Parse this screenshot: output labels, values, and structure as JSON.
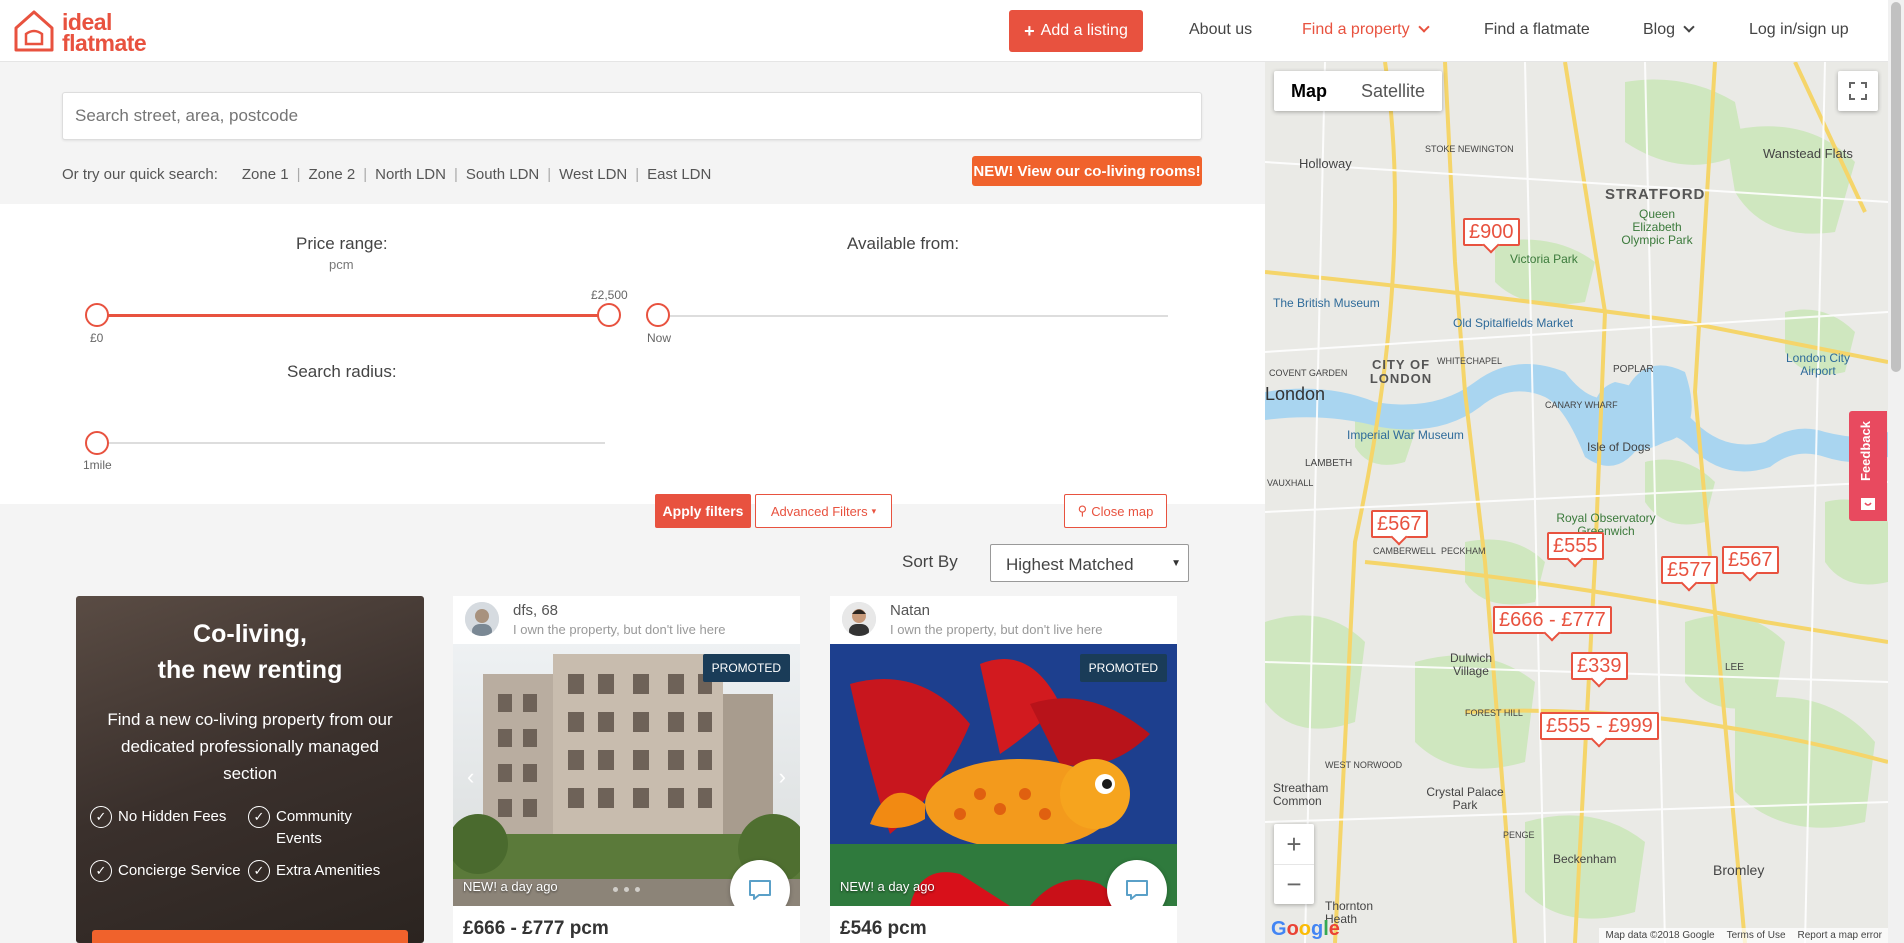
{
  "brand": {
    "line1": "ideal",
    "line2": "flatmate",
    "color": "#e8523f"
  },
  "header": {
    "add_listing": "Add a listing",
    "nav": {
      "about": "About us",
      "find_property": "Find a property",
      "find_flatmate": "Find a flatmate",
      "blog": "Blog",
      "login": "Log in/sign up"
    }
  },
  "search": {
    "placeholder": "Search street, area, postcode",
    "quick_label": "Or try our quick search:",
    "quick_links": [
      "Zone 1",
      "Zone 2",
      "North LDN",
      "South LDN",
      "West LDN",
      "East LDN"
    ],
    "coliving_button": "NEW! View our co-living rooms!"
  },
  "filters": {
    "price_label": "Price range:",
    "price_unit": "pcm",
    "price_min": "£0",
    "price_max": "£2,500",
    "available_label": "Available from:",
    "available_value": "Now",
    "radius_label": "Search radius:",
    "radius_value": "1mile",
    "apply": "Apply filters",
    "advanced": "Advanced Filters",
    "close_map": "Close map"
  },
  "sort": {
    "label": "Sort By",
    "selected": "Highest Matched"
  },
  "promo": {
    "title_line1": "Co-living,",
    "title_line2": "the new renting",
    "text": "Find a new co-living property from our dedicated professionally managed section",
    "features": [
      "No Hidden Fees",
      "Community Events",
      "Concierge Service",
      "Extra Amenities"
    ]
  },
  "listings": [
    {
      "owner": "dfs, 68",
      "owner_sub": "I own the property, but don't live here",
      "badge": "PROMOTED",
      "new_tag": "NEW! a day ago",
      "price": "£666 - £777 pcm"
    },
    {
      "owner": "Natan",
      "owner_sub": "I own the property, but don't live here",
      "badge": "PROMOTED",
      "new_tag": "NEW! a day ago",
      "price": "£546 pcm"
    }
  ],
  "map": {
    "type_map": "Map",
    "type_satellite": "Satellite",
    "pins": [
      "£900",
      "£567",
      "£555",
      "£577",
      "£567",
      "£666 - £777",
      "£339",
      "£555 - £999"
    ],
    "labels": {
      "holloway": "Holloway",
      "stoke_newington": "STOKE NEWINGTON",
      "wanstead_flats": "Wanstead Flats",
      "stratford": "STRATFORD",
      "olympic_park": "Queen Elizabeth Olympic Park",
      "victoria_park": "Victoria Park",
      "british_museum": "The British Museum",
      "spitalfields": "Old Spitalfields Market",
      "city_of_london": "CITY OF LONDON",
      "whitechapel": "WHITECHAPEL",
      "poplar": "POPLAR",
      "london_city_airport": "London City Airport",
      "covent_garden": "COVENT GARDEN",
      "london": "London",
      "canary_wharf": "CANARY WHARF",
      "imperial_war_museum": "Imperial War Museum",
      "isle_of_dogs": "Isle of Dogs",
      "lambeth": "LAMBETH",
      "vauxhall": "VAUXHALL",
      "royal_observatory": "Royal Observatory Greenwich",
      "camberwell": "CAMBERWELL",
      "peckham": "PECKHAM",
      "dulwich": "Dulwich Village",
      "lee": "LEE",
      "forest_hill": "FOREST HILL",
      "west_norwood": "WEST NORWOOD",
      "streatham": "Streatham Common",
      "crystal_palace": "Crystal Palace Park",
      "penge": "PENGE",
      "beckenham": "Beckenham",
      "bromley": "Bromley",
      "thornton_heath": "Thornton Heath"
    },
    "footer": {
      "data": "Map data ©2018 Google",
      "terms": "Terms of Use",
      "report": "Report a map error"
    },
    "google": "Google"
  },
  "feedback": "Feedback"
}
